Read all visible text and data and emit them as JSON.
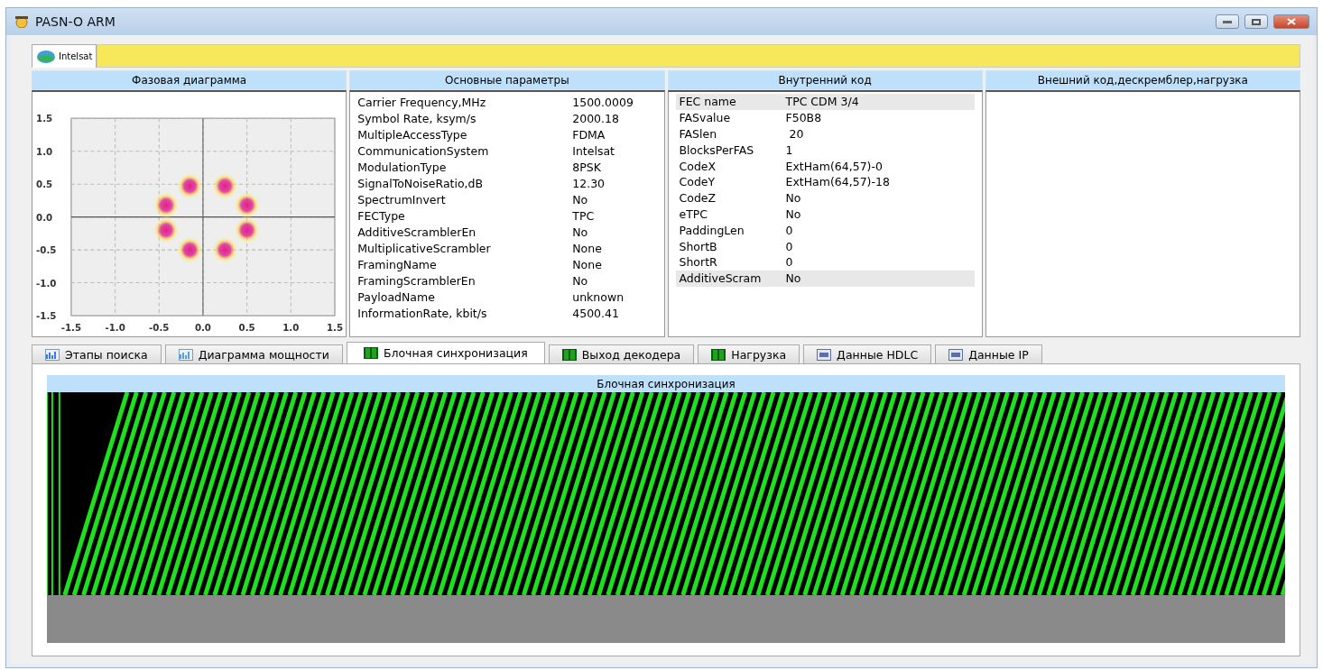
{
  "window": {
    "title": "PASN-O ARM"
  },
  "system_tab": {
    "label": "Intelsat"
  },
  "panels": [
    {
      "title": "Фазовая диаграмма"
    },
    {
      "title": "Основные параметры"
    },
    {
      "title": "Внутренний код"
    },
    {
      "title": "Внешний код,дескремблер,нагрузка"
    }
  ],
  "phase_chart": {
    "chart_data": {
      "type": "scatter",
      "grid": true,
      "xlim": [
        -1.5,
        1.5
      ],
      "ylim": [
        -1.5,
        1.5
      ],
      "xticks": [
        {
          "value": -1.5,
          "label": "-1.5"
        },
        {
          "value": -1,
          "label": "-1.0"
        },
        {
          "value": -0.5,
          "label": "-0.5"
        },
        {
          "value": 0,
          "label": "0.0"
        },
        {
          "value": 0.5,
          "label": "0.5"
        },
        {
          "value": 1,
          "label": "1.0"
        },
        {
          "value": 1.5,
          "label": "1.5"
        }
      ],
      "yticks": [
        {
          "value": -1.5,
          "label": "-1.5"
        },
        {
          "value": -1,
          "label": "-1.0"
        },
        {
          "value": -0.5,
          "label": "-0.5"
        },
        {
          "value": 0,
          "label": "0.0"
        },
        {
          "value": 0.5,
          "label": "0.5"
        },
        {
          "value": 1,
          "label": "1.0"
        },
        {
          "value": 1.5,
          "label": "1.5"
        }
      ],
      "x": [
        -0.15,
        0.25,
        0.5,
        0.5,
        0.25,
        -0.15,
        -0.42,
        -0.42
      ],
      "series": [
        {
          "color": "#e0208c",
          "values": [
            0.47,
            0.47,
            0.18,
            -0.2,
            -0.5,
            -0.5,
            -0.2,
            0.18
          ]
        }
      ]
    }
  },
  "main_params": [
    {
      "name": "Carrier Frequency,MHz",
      "value": "1500.0009"
    },
    {
      "name": "Symbol Rate, ksym/s",
      "value": "2000.18"
    },
    {
      "name": "MultipleAccessType",
      "value": "FDMA"
    },
    {
      "name": "CommunicationSystem",
      "value": "Intelsat"
    },
    {
      "name": "ModulationType",
      "value": "8PSK"
    },
    {
      "name": "SignalToNoiseRatio,dB",
      "value": "12.30"
    },
    {
      "name": "SpectrumInvert",
      "value": "No"
    },
    {
      "name": "FECType",
      "value": "TPC"
    },
    {
      "name": "AdditiveScramblerEn",
      "value": "No"
    },
    {
      "name": "MultiplicativeScrambler",
      "value": "None"
    },
    {
      "name": "FramingName",
      "value": "None"
    },
    {
      "name": "FramingScramblerEn",
      "value": "No"
    },
    {
      "name": "PayloadName",
      "value": "unknown"
    },
    {
      "name": "InformationRate, kbit/s",
      "value": "4500.41"
    }
  ],
  "inner_code": [
    {
      "name": "FEC name",
      "value": "TPC CDM 3/4",
      "selected": true
    },
    {
      "name": "FASvalue",
      "value": "F50B8",
      "selected": false
    },
    {
      "name": "FASlen",
      "value": " 20",
      "selected": false
    },
    {
      "name": "BlocksPerFAS",
      "value": "1",
      "selected": false
    },
    {
      "name": "CodeX",
      "value": "ExtHam(64,57)-0",
      "selected": false
    },
    {
      "name": "CodeY",
      "value": "ExtHam(64,57)-18",
      "selected": false
    },
    {
      "name": "CodeZ",
      "value": "No",
      "selected": false
    },
    {
      "name": "eTPC",
      "value": "No",
      "selected": false
    },
    {
      "name": "PaddingLen",
      "value": "0",
      "selected": false
    },
    {
      "name": "ShortB",
      "value": "0",
      "selected": false
    },
    {
      "name": "ShortR",
      "value": "0",
      "selected": false
    },
    {
      "name": "AdditiveScram",
      "value": "No",
      "selected": true
    }
  ],
  "tabs": [
    {
      "label": "Этапы поиска",
      "selected": false
    },
    {
      "label": "Диаграмма мощности",
      "selected": false
    },
    {
      "label": "Блочная синхронизация",
      "selected": true
    },
    {
      "label": "Выход декодера",
      "selected": false
    },
    {
      "label": "Нагрузка",
      "selected": false
    },
    {
      "label": "Данные HDLC",
      "selected": false
    },
    {
      "label": "Данные IP",
      "selected": false
    }
  ],
  "sync_view": {
    "title": "Блочная синхронизация"
  }
}
